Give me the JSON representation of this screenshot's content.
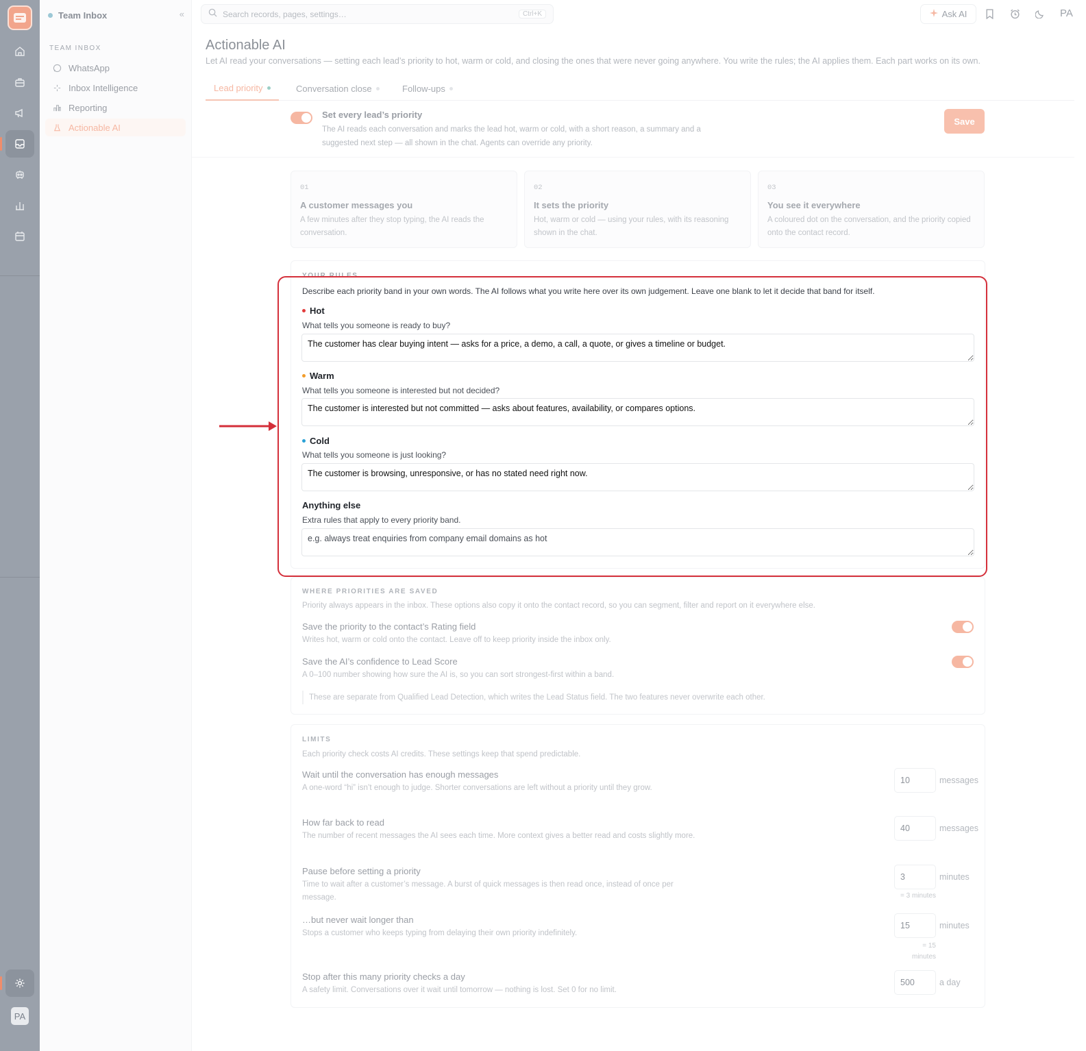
{
  "workspace": {
    "name": "Team Inbox"
  },
  "sidebar": {
    "section": "TEAM INBOX",
    "items": [
      {
        "label": "WhatsApp",
        "icon": "whatsapp-icon"
      },
      {
        "label": "Inbox Intelligence",
        "icon": "sparkles-icon"
      },
      {
        "label": "Reporting",
        "icon": "bar-chart-icon"
      },
      {
        "label": "Actionable AI",
        "icon": "flask-icon",
        "active": true
      }
    ]
  },
  "rail": {
    "items": [
      "home-icon",
      "briefcase-icon",
      "megaphone-icon",
      "inbox-icon",
      "robot-icon",
      "chart-icon",
      "calendar-icon"
    ],
    "active": "inbox-icon",
    "settings": "gear-icon",
    "avatar": "PA"
  },
  "search": {
    "placeholder": "Search records, pages, settings…",
    "shortcut": "Ctrl+K"
  },
  "topbar": {
    "ask_ai": "Ask AI",
    "user": "PA"
  },
  "page": {
    "title": "Actionable AI",
    "subtitle": "Let AI read your conversations — setting each lead’s priority to hot, warm or cold, and closing the ones that were never going anywhere. You write the rules; the AI applies them. Each part works on its own."
  },
  "tabs": [
    {
      "label": "Lead priority",
      "active": true
    },
    {
      "label": "Conversation close"
    },
    {
      "label": "Follow-ups"
    }
  ],
  "feature": {
    "enabled": true,
    "title": "Set every lead’s priority",
    "description": "The AI reads each conversation and marks the lead hot, warm or cold, with a short reason, a summary and a suggested next step — all shown in the chat. Agents can override any priority.",
    "save_label": "Save"
  },
  "steps": [
    {
      "num": "01",
      "title": "A customer messages you",
      "desc": "A few minutes after they stop typing, the AI reads the conversation."
    },
    {
      "num": "02",
      "title": "It sets the priority",
      "desc": "Hot, warm or cold — using your rules, with its reasoning shown in the chat."
    },
    {
      "num": "03",
      "title": "You see it everywhere",
      "desc": "A coloured dot on the conversation, and the priority copied onto the contact record."
    }
  ],
  "rules": {
    "section": "YOUR RULES",
    "description": "Describe each priority band in your own words. The AI follows what you write here over its own judgement. Leave one blank to let it decide that band for itself.",
    "bands": [
      {
        "name": "Hot",
        "color": "#e23b3b",
        "question": "What tells you someone is ready to buy?",
        "value": "The customer has clear buying intent — asks for a price, a demo, a call, a quote, or gives a timeline or budget."
      },
      {
        "name": "Warm",
        "color": "#f29d2c",
        "question": "What tells you someone is interested but not decided?",
        "value": "The customer is interested but not committed — asks about features, availability, or compares options."
      },
      {
        "name": "Cold",
        "color": "#2aa1d6",
        "question": "What tells you someone is just looking?",
        "value": "The customer is browsing, unresponsive, or has no stated need right now."
      }
    ],
    "extra": {
      "title": "Anything else",
      "question": "Extra rules that apply to every priority band.",
      "placeholder": "e.g. always treat enquiries from company email domains as hot"
    }
  },
  "saved": {
    "section": "WHERE PRIORITIES ARE SAVED",
    "description": "Priority always appears in the inbox. These options also copy it onto the contact record, so you can segment, filter and report on it everywhere else.",
    "options": [
      {
        "title": "Save the priority to the contact’s Rating field",
        "desc": "Writes hot, warm or cold onto the contact. Leave off to keep priority inside the inbox only.",
        "enabled": true
      },
      {
        "title": "Save the AI’s confidence to Lead Score",
        "desc": "A 0–100 number showing how sure the AI is, so you can sort strongest-first within a band.",
        "enabled": true
      }
    ],
    "note": "These are separate from Qualified Lead Detection, which writes the Lead Status field. The two features never overwrite each other."
  },
  "limits": {
    "section": "LIMITS",
    "description": "Each priority check costs AI credits. These settings keep that spend predictable.",
    "items": [
      {
        "title": "Wait until the conversation has enough messages",
        "desc": "A one-word “hi” isn’t enough to judge. Shorter conversations are left without a priority until they grow.",
        "value": "10",
        "unit": "messages",
        "hint": ""
      },
      {
        "title": "How far back to read",
        "desc": "The number of recent messages the AI sees each time. More context gives a better read and costs slightly more.",
        "value": "40",
        "unit": "messages",
        "hint": ""
      },
      {
        "title": "Pause before setting a priority",
        "desc": "Time to wait after a customer’s message. A burst of quick messages is then read once, instead of once per message.",
        "value": "3",
        "unit": "minutes",
        "hint": "= 3 minutes"
      },
      {
        "title": "…but never wait longer than",
        "desc": "Stops a customer who keeps typing from delaying their own priority indefinitely.",
        "value": "15",
        "unit": "minutes",
        "hint": "= 15 minutes"
      },
      {
        "title": "Stop after this many priority checks a day",
        "desc": "A safety limit. Conversations over it wait until tomorrow — nothing is lost. Set 0 for no limit.",
        "value": "500",
        "unit": "a day",
        "hint": ""
      }
    ]
  }
}
